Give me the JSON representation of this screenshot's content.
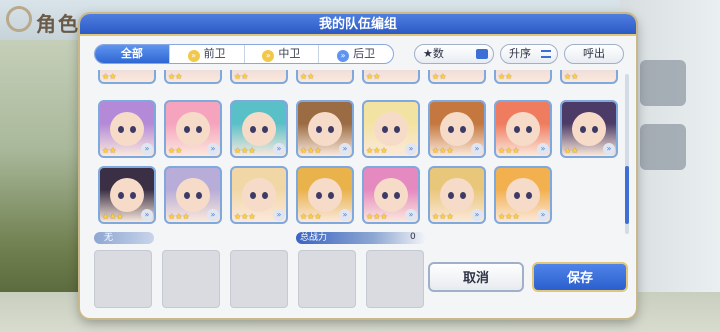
{
  "background": {
    "title": "角色"
  },
  "dialog": {
    "title": "我的队伍编组",
    "tabs": [
      {
        "label": "全部",
        "active": true
      },
      {
        "label": "前卫",
        "active": false
      },
      {
        "label": "中卫",
        "active": false
      },
      {
        "label": "后卫",
        "active": false
      }
    ],
    "sort_stat_label": "★数",
    "sort_order_label": "升序",
    "summon_label": "呼出",
    "roster_rows": [
      [
        {
          "stars": "★★",
          "hair": "#b48ad8"
        },
        {
          "stars": "★★",
          "hair": "#f6a4be"
        },
        {
          "stars": "★★★",
          "hair": "#5ac0c8"
        },
        {
          "stars": "★★★",
          "hair": "#9b6b44"
        },
        {
          "stars": "★★★",
          "hair": "#f3e3a2"
        },
        {
          "stars": "★★★",
          "hair": "#c4783f"
        },
        {
          "stars": "★★★",
          "hair": "#f07c60"
        },
        {
          "stars": "★★",
          "hair": "#4c3b66"
        }
      ],
      [
        {
          "stars": "★★★",
          "hair": "#3a2f45"
        },
        {
          "stars": "★★★",
          "hair": "#b8acd8"
        },
        {
          "stars": "★★★",
          "hair": "#f2d7a6"
        },
        {
          "stars": "★★★",
          "hair": "#e9b24b"
        },
        {
          "stars": "★★★",
          "hair": "#e58ac0"
        },
        {
          "stars": "★★★",
          "hair": "#e9c77a"
        },
        {
          "stars": "★★★",
          "hair": "#f3b04e"
        }
      ]
    ],
    "team": {
      "slot_label": "无",
      "power_label": "总战力",
      "power_value": "0"
    },
    "buttons": {
      "cancel": "取消",
      "save": "保存"
    }
  }
}
